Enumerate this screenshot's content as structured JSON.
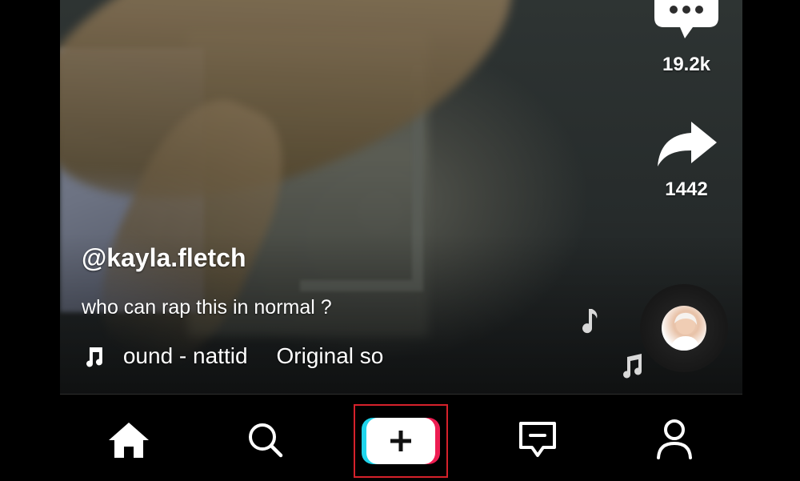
{
  "video": {
    "username": "@kayla.fletch",
    "caption": "who can rap this in normal ?",
    "sound": {
      "icon": "music-note-icon",
      "marquee_left": "ound - nattid",
      "marquee_right": "Original so"
    },
    "disc_avatar": "sound-disc-avatar"
  },
  "actions": {
    "comments": {
      "icon": "comment-bubble-icon",
      "count": "19.2k"
    },
    "shares": {
      "icon": "share-arrow-icon",
      "count": "1442"
    }
  },
  "navbar": {
    "items": [
      {
        "name": "home",
        "icon": "home-icon"
      },
      {
        "name": "discover",
        "icon": "search-icon"
      },
      {
        "name": "create",
        "icon": "plus-icon",
        "highlighted": true
      },
      {
        "name": "inbox",
        "icon": "inbox-icon"
      },
      {
        "name": "profile",
        "icon": "profile-icon"
      }
    ]
  },
  "colors": {
    "create_cyan": "#20d5ec",
    "create_pink": "#ee1d52",
    "highlight_box": "#d6212b",
    "text": "#ffffff"
  }
}
